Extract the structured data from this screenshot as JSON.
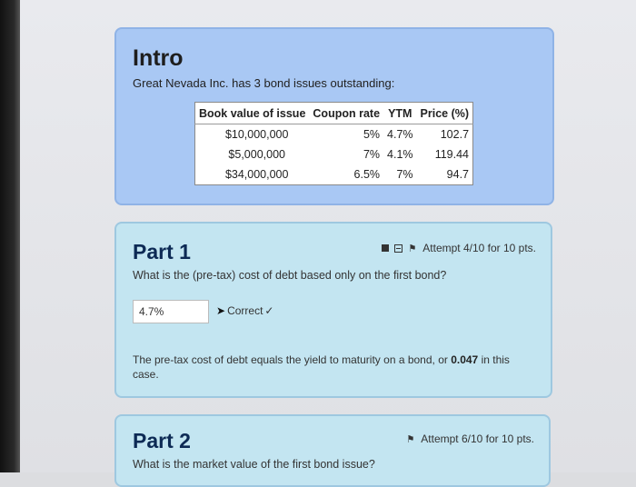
{
  "intro": {
    "title": "Intro",
    "description": "Great Nevada Inc. has 3 bond issues outstanding:",
    "table": {
      "headers": [
        "Book value of issue",
        "Coupon rate",
        "YTM",
        "Price (%)"
      ],
      "rows": [
        [
          "$10,000,000",
          "5%",
          "4.7%",
          "102.7"
        ],
        [
          "$5,000,000",
          "7%",
          "4.1%",
          "119.44"
        ],
        [
          "$34,000,000",
          "6.5%",
          "7%",
          "94.7"
        ]
      ]
    }
  },
  "part1": {
    "title": "Part 1",
    "attempt": "Attempt 4/10 for 10 pts.",
    "question": "What is the (pre-tax) cost of debt based only on the first bond?",
    "answer_value": "4.7%",
    "status": "Correct",
    "explanation_pre": "The pre-tax cost of debt equals the yield to maturity on a bond, or ",
    "explanation_value": "0.047",
    "explanation_post": " in this case."
  },
  "part2": {
    "title": "Part 2",
    "attempt": "Attempt 6/10 for 10 pts.",
    "question": "What is the market value of the first bond issue?"
  }
}
